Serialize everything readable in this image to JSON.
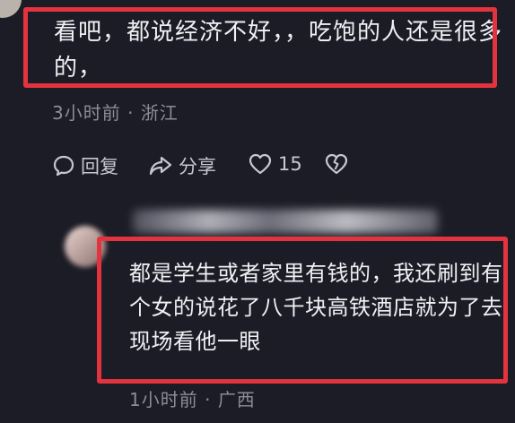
{
  "comment_1": {
    "text": "看吧，都说经济不好，，吃饱的人还是很多的，",
    "time": "3小时前",
    "location": "浙江",
    "separator": "·"
  },
  "actions": {
    "reply_label": "回复",
    "share_label": "分享",
    "like_count": "15"
  },
  "reply_1": {
    "text": "都是学生或者家里有钱的，我还刷到有个女的说花了八千块高铁酒店就为了去现场看他一眼",
    "time": "1小时前",
    "location": "广西",
    "separator": "·"
  },
  "colors": {
    "background": "#1c1c26",
    "highlight": "#e3333f",
    "meta_text": "#8c8c99"
  },
  "icons": {
    "reply": "comment-bubble-icon",
    "share": "share-arrow-icon",
    "like": "heart-icon",
    "dislike": "broken-heart-icon"
  }
}
